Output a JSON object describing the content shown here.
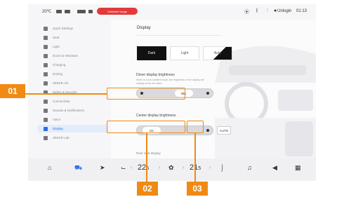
{
  "status_bar": {
    "temperature": "20℃",
    "alert_pill": "Unlimited range",
    "user": "Unlogin",
    "time": "01:13"
  },
  "sidebar": {
    "items": [
      {
        "label": "Quick Settings",
        "icon": "quick-settings-icon"
      },
      {
        "label": "Seat",
        "icon": "seat-icon"
      },
      {
        "label": "Light",
        "icon": "light-icon"
      },
      {
        "label": "Doors & Windows",
        "icon": "door-icon"
      },
      {
        "label": "Charging",
        "icon": "charging-icon"
      },
      {
        "label": "Driving",
        "icon": "driving-icon"
      },
      {
        "label": "ZEEKR AD",
        "icon": "steering-icon"
      },
      {
        "label": "Safety & Security",
        "icon": "shield-icon"
      },
      {
        "label": "Connectivity",
        "icon": "wifi-icon"
      },
      {
        "label": "Sounds & Notifications",
        "icon": "sound-icon"
      },
      {
        "label": "Voice",
        "icon": "voice-icon"
      },
      {
        "label": "Display",
        "icon": "display-icon",
        "active": true
      },
      {
        "label": "ZEEKR Lab",
        "icon": "lab-icon"
      }
    ]
  },
  "main": {
    "title": "Display",
    "modes": {
      "dark": "Dark",
      "light": "Light",
      "auto": "Auto"
    },
    "driver_brightness": {
      "label": "Driver display brightness",
      "description": "When in a low ambient mode, the brightness of the display will change to the set value.",
      "value": "Btn",
      "level": 0.75
    },
    "center_brightness": {
      "label": "Center display brightness",
      "value": "Ds",
      "level": 0.1,
      "auto_label": "AUTO"
    },
    "rear_label": "Rear seat display"
  },
  "dock": {
    "left_temp": "22",
    "left_temp_unit": "5",
    "right_temp": "21",
    "right_temp_unit": "5"
  },
  "callouts": {
    "c1": "01",
    "c2": "02",
    "c3": "03"
  },
  "colors": {
    "accent": "#2c6ee0",
    "callout": "#f08a14",
    "alert": "#e23a3a"
  }
}
